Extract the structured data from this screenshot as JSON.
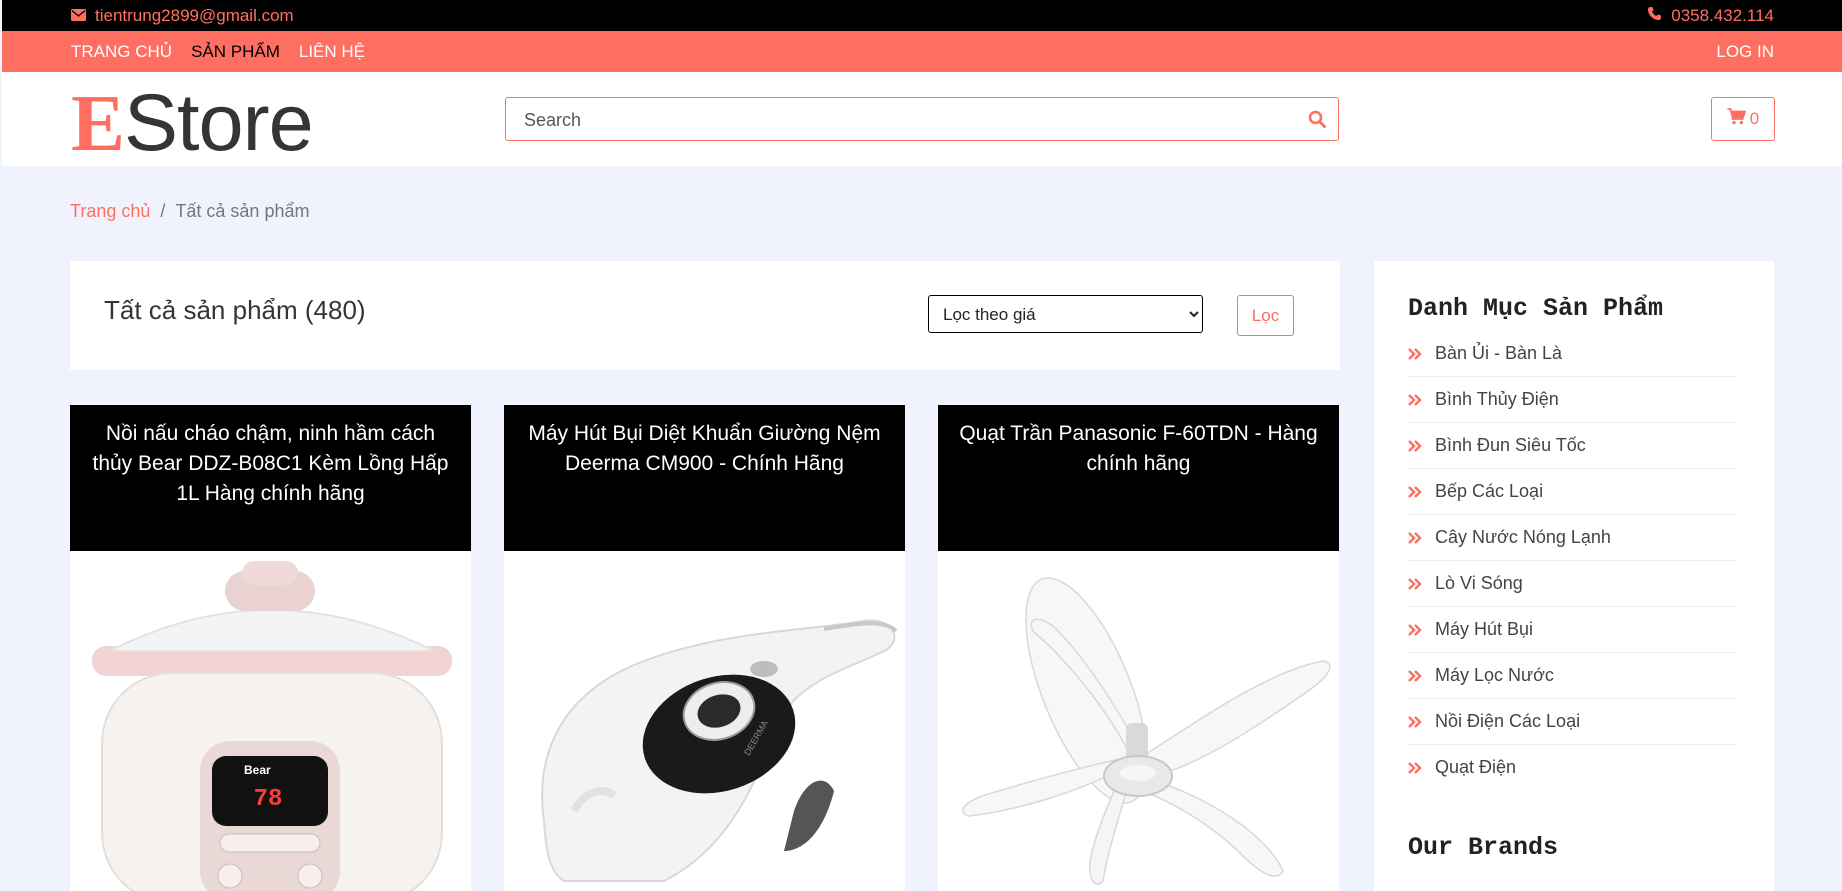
{
  "topbar": {
    "email": "tientrung2899@gmail.com",
    "phone": "0358.432.114"
  },
  "nav": {
    "items": [
      {
        "label": "TRANG CHỦ"
      },
      {
        "label": "SẢN PHẨM"
      },
      {
        "label": "LIÊN HỆ"
      }
    ],
    "active_item": "SẢN PHẨM",
    "login": "LOG IN"
  },
  "header": {
    "logo_first": "E",
    "logo_rest": "Store",
    "search_placeholder": "Search",
    "cart_count": "0"
  },
  "breadcrumb": {
    "home": "Trang chủ",
    "separator": "/",
    "current": "Tất cả sản phẩm"
  },
  "toolbar": {
    "title": "Tất cả sản phẩm (480)",
    "filter_selected": "Lọc theo giá",
    "filter_button": "Lọc"
  },
  "products": [
    {
      "title": "Nồi nấu cháo chậm, ninh hầm cách thủy Bear DDZ-B08C1 Kèm Lồng Hấp 1L Hàng chính hãng"
    },
    {
      "title": "Máy Hút Bụi Diệt Khuẩn Giường Nệm Deerma CM900 - Chính Hãng"
    },
    {
      "title": "Quạt Trần Panasonic F-60TDN - Hàng chính hãng"
    }
  ],
  "product_images": {
    "cooker_brand": "Bear",
    "cooker_display": "78",
    "vacuum_brand": "DEERMA"
  },
  "sidebar": {
    "categories_title": "Danh Mục Sản Phẩm",
    "categories": [
      {
        "label": "Bàn Ủi - Bàn Là"
      },
      {
        "label": "Bình Thủy Điện"
      },
      {
        "label": "Bình Đun Siêu Tốc"
      },
      {
        "label": "Bếp Các Loại"
      },
      {
        "label": "Cây Nước Nóng Lạnh"
      },
      {
        "label": "Lò Vi Sóng"
      },
      {
        "label": "Máy Hút Bụi"
      },
      {
        "label": "Máy Lọc Nước"
      },
      {
        "label": "Nồi Điện Các Loại"
      },
      {
        "label": "Quạt Điện"
      }
    ],
    "brands_title": "Our Brands"
  },
  "colors": {
    "accent": "#ff6f61",
    "topbar_bg": "#000000",
    "page_bg": "#f0f3fd"
  }
}
